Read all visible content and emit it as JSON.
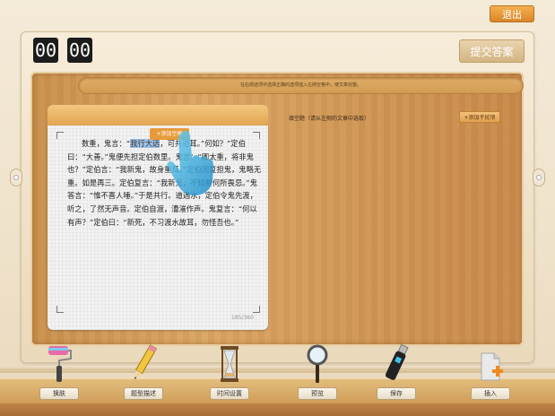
{
  "header": {
    "exit_label": "退出",
    "submit_label": "提交答案"
  },
  "timer": {
    "minutes": "00",
    "seconds": "00"
  },
  "instruction": "在右侧选项中选择正确的选项插入左侧空格中，使文章完整。",
  "editor": {
    "add_blank_label": "+添加空格",
    "story": "数重，鬼言：“我行大远，可共迹耳。”何如？”定伯曰：“大善。”鬼便先担定伯数里。鬼言：“卿太重，将非鬼也？”定伯言：“我新鬼，故身重耳。”定伯因复担鬼，鬼略无重。如是再三。定伯复言：“我新鬼，不知有何所畏忌。”鬼答言：“惟不喜人唾。”于是共行。道遇水，定伯令鬼先渡，听之，了然无声音。定伯自渡，漕漼作声。鬼复言：“何以有声？”定伯曰：“新死，不习渡水故耳，勿怪吾也。”",
    "highlight": "我行大远",
    "counter": "185/360"
  },
  "options_panel": {
    "label": "填空题（请从左侧的文章中选取）",
    "add_option_label": "+添加干扰项"
  },
  "toolbar": {
    "items": [
      {
        "label": "换肤",
        "icon": "paint-roller-icon"
      },
      {
        "label": "题型描述",
        "icon": "pencil-icon"
      },
      {
        "label": "时间设置",
        "icon": "hourglass-icon"
      },
      {
        "label": "预览",
        "icon": "magnifier-icon"
      },
      {
        "label": "保存",
        "icon": "usb-drive-icon"
      },
      {
        "label": "插入",
        "icon": "insert-page-icon"
      }
    ]
  }
}
